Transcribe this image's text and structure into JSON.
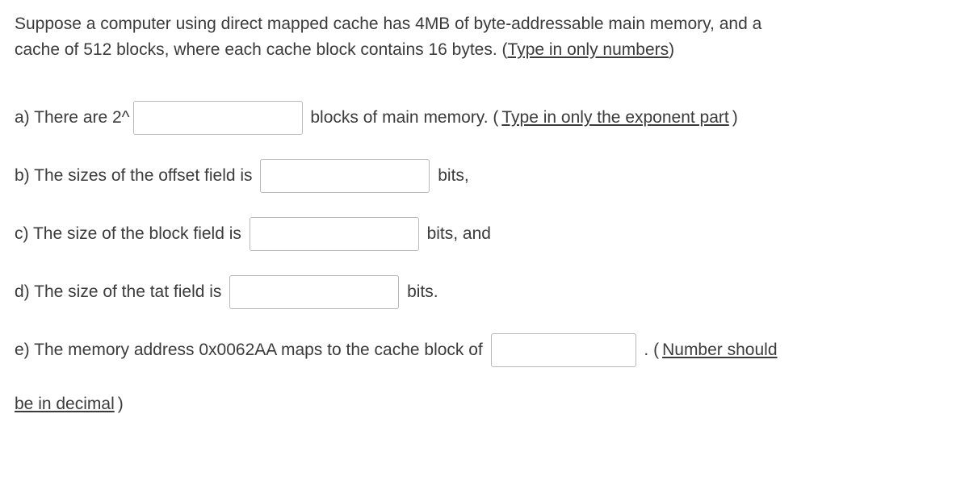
{
  "intro": {
    "line1": "Suppose a computer using direct mapped cache has 4MB of byte-addressable main memory, and a",
    "line2_pre": "cache of 512 blocks, where each cache block contains 16 bytes.  (",
    "line2_u": "Type in only numbers",
    "line2_post": ")"
  },
  "a": {
    "pre": "a) There are 2^",
    "post_pre": " blocks of main memory. (",
    "post_u": "Type in only the exponent part",
    "post_post": ")"
  },
  "b": {
    "pre": "b) The sizes of the offset field is ",
    "post": " bits,"
  },
  "c": {
    "pre": "c) The size of the block field is ",
    "post": " bits, and"
  },
  "d": {
    "pre": "d) The size of the tat field is ",
    "post": " bits."
  },
  "e": {
    "pre": "e) The memory address 0x0062AA maps to the cache block of ",
    "post_pre": " . (",
    "post_u": "Number should",
    "line2_u": "be in decimal",
    "line2_post": ")"
  }
}
